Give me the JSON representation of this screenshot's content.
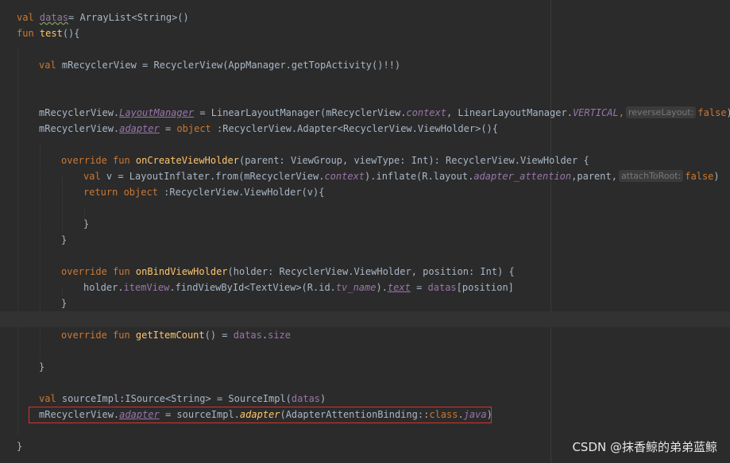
{
  "editor": {
    "lines": [
      [
        [
          "kw",
          "val "
        ],
        [
          "wavy prop",
          "datas"
        ],
        [
          "",
          "= ArrayList<String>()"
        ]
      ],
      [
        [
          "kw",
          "fun "
        ],
        [
          "fn",
          "test"
        ],
        [
          "",
          "(){"
        ]
      ],
      [],
      [
        [
          "kw",
          "val "
        ],
        [
          "",
          "mRecyclerView = RecyclerView(AppManager.getTopActivity()!!)"
        ]
      ],
      [],
      [],
      [
        [
          "",
          "mRecyclerView."
        ],
        [
          "prop ital ul",
          "LayoutManager"
        ],
        [
          "",
          "= LinearLayoutManager(mRecyclerView."
        ],
        [
          "prop ital",
          "context"
        ],
        [
          "",
          ", LinearLayoutManager."
        ],
        [
          "prop ital",
          "VERTICAL"
        ],
        [
          "kw",
          ","
        ],
        [
          "hint",
          "reverseLayout:"
        ],
        [
          "kw",
          "false"
        ],
        [
          "",
          ")"
        ]
      ],
      [
        [
          "",
          "mRecyclerView."
        ],
        [
          "prop ital ul",
          "adapter"
        ],
        [
          "",
          "= "
        ],
        [
          "kw",
          "object "
        ],
        [
          "",
          ":RecyclerView.Adapter<RecyclerView.ViewHolder>(){"
        ]
      ],
      [],
      [
        [
          "kw",
          "override fun "
        ],
        [
          "fn",
          "onCreateViewHolder"
        ],
        [
          "",
          "(parent: ViewGroup, viewType: Int): RecyclerView.ViewHolder {"
        ]
      ],
      [
        [
          "kw",
          "val "
        ],
        [
          "",
          "v = LayoutInflater.from(mRecyclerView."
        ],
        [
          "prop ital",
          "context"
        ],
        [
          "",
          ").inflate(R.layout."
        ],
        [
          "prop ital",
          "adapter_attention"
        ],
        [
          "",
          ",parent,"
        ],
        [
          "hint",
          "attachToRoot:"
        ],
        [
          "kw",
          "false"
        ],
        [
          "",
          ")"
        ]
      ],
      [
        [
          "kw",
          "return object "
        ],
        [
          "",
          ":RecyclerView.ViewHolder(v){"
        ]
      ],
      [],
      [
        [
          "",
          "}"
        ]
      ],
      [
        [
          "",
          "}"
        ]
      ],
      [],
      [
        [
          "kw",
          "override fun "
        ],
        [
          "fn",
          "onBindViewHolder"
        ],
        [
          "",
          "(holder: RecyclerView.ViewHolder, position: Int) {"
        ]
      ],
      [
        [
          "",
          "holder."
        ],
        [
          "prop",
          "itemView"
        ],
        [
          "",
          ".findViewById<TextView>(R.id."
        ],
        [
          "prop ital",
          "tv_name"
        ],
        [
          "",
          ")."
        ],
        [
          "prop ital ul",
          "text"
        ],
        [
          "",
          "= "
        ],
        [
          "prop",
          "datas"
        ],
        [
          "",
          "[position]"
        ]
      ],
      [
        [
          "",
          "}"
        ]
      ],
      [],
      [
        [
          "kw",
          "override fun "
        ],
        [
          "fn",
          "getItemCount"
        ],
        [
          "",
          "() = "
        ],
        [
          "prop",
          "datas"
        ],
        [
          "",
          "."
        ],
        [
          "prop",
          "size"
        ]
      ],
      [],
      [
        [
          "",
          "}"
        ]
      ],
      [],
      [
        [
          "kw",
          "val "
        ],
        [
          "",
          "sourceImpl:ISource<String> = SourceImpl("
        ],
        [
          "prop",
          "datas"
        ],
        [
          "",
          ")"
        ]
      ],
      [
        [
          "",
          "mRecyclerView."
        ],
        [
          "prop ital ul",
          "adapter"
        ],
        [
          "",
          "= sourceImpl."
        ],
        [
          "fn ital",
          "adapter"
        ],
        [
          "",
          "(AdapterAttentionBinding::"
        ],
        [
          "kw",
          "class"
        ],
        [
          "",
          "."
        ],
        [
          "prop ital",
          "java"
        ],
        [
          "",
          ")"
        ]
      ],
      [],
      [
        [
          "",
          "}"
        ]
      ]
    ]
  },
  "watermark": "CSDN @抹香鲸的弟弟蓝鲸"
}
